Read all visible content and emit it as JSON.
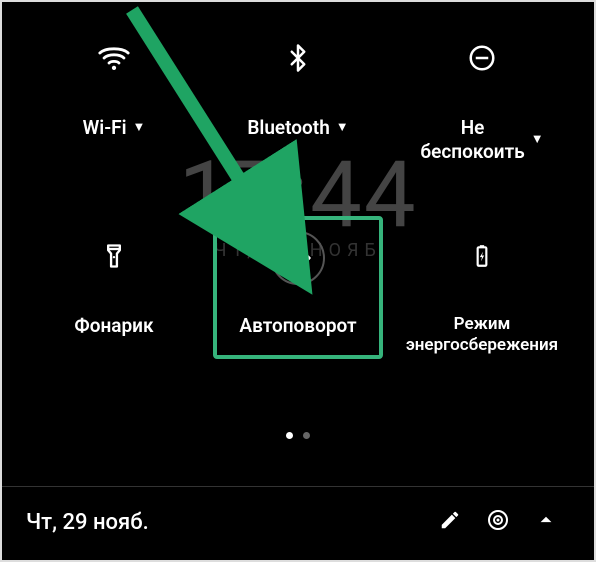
{
  "clock": {
    "time": "17:44",
    "date": "Чт, 29 нояб"
  },
  "tiles": {
    "row1": [
      {
        "label": "Wi-Fi",
        "has_dropdown": true
      },
      {
        "label": "Bluetooth",
        "has_dropdown": true
      },
      {
        "label": "Не\nбеспокоить",
        "has_dropdown": true
      }
    ],
    "row2": [
      {
        "label": "Фонарик",
        "has_dropdown": false
      },
      {
        "label": "Автоповорот",
        "has_dropdown": false,
        "highlighted": true
      },
      {
        "label": "Режим\nэнергосбережения",
        "has_dropdown": false
      }
    ]
  },
  "pager": {
    "total": 2,
    "active": 1
  },
  "footer": {
    "date": "Чт, 29 нояб."
  }
}
